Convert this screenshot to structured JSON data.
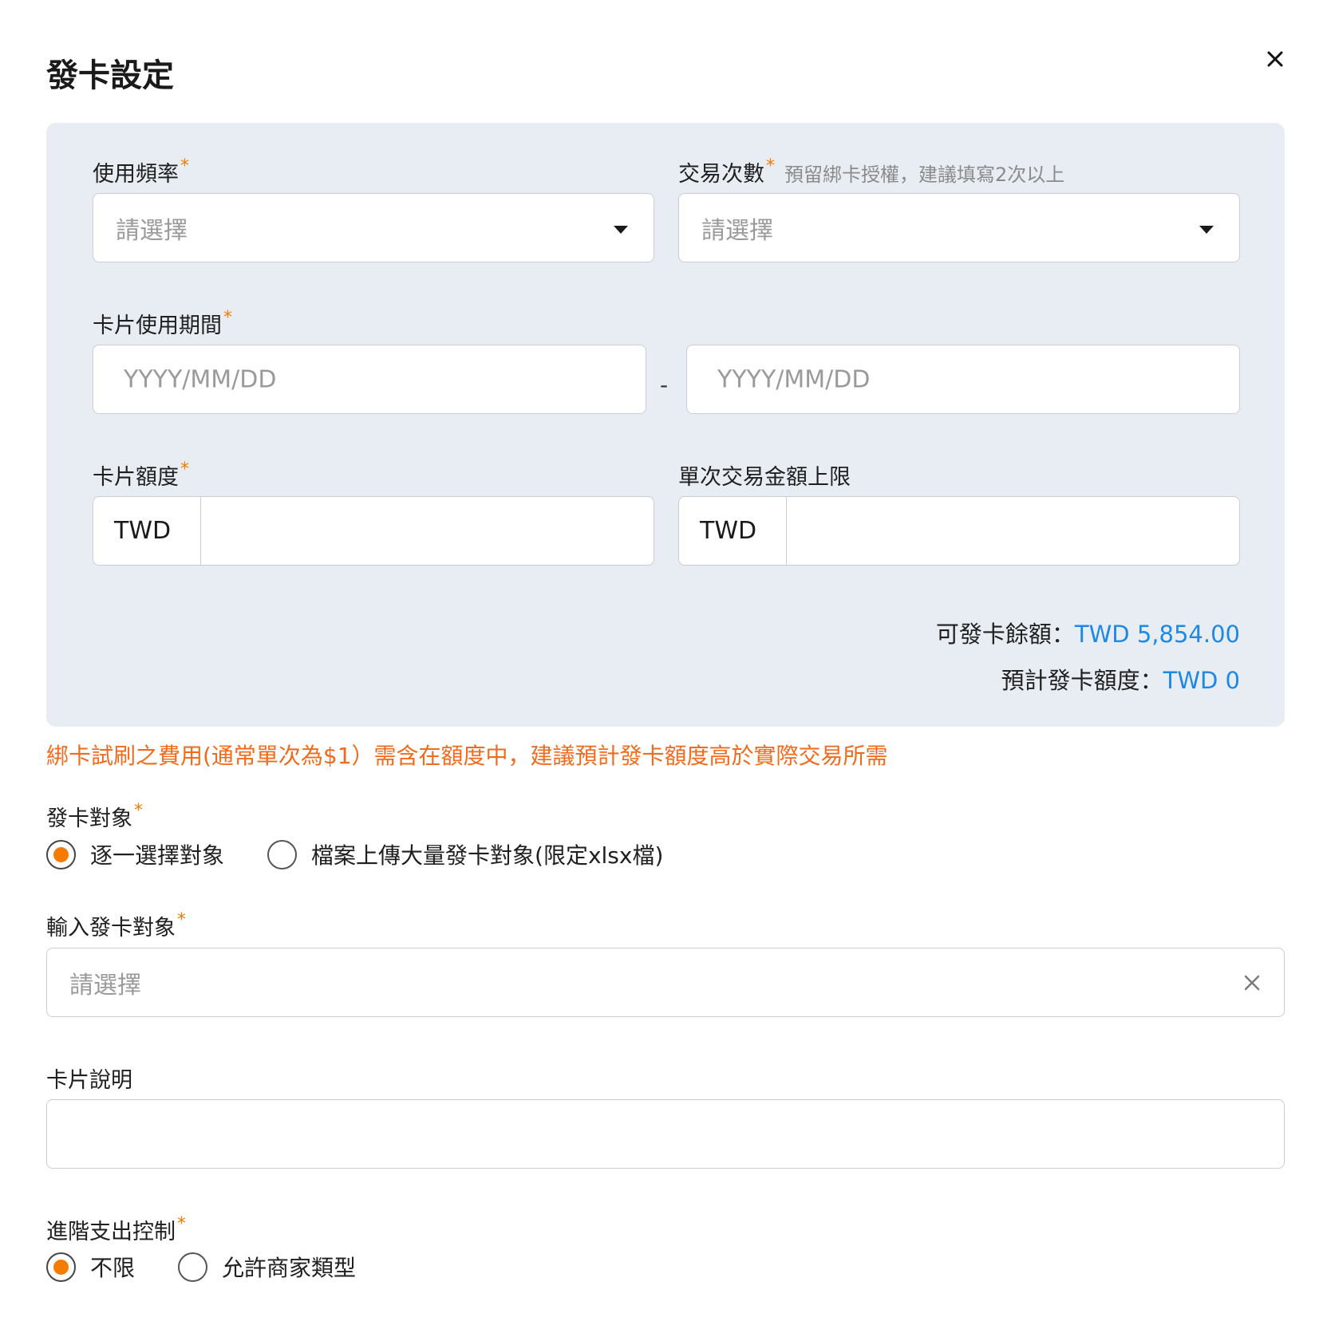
{
  "dialog": {
    "title": "發卡設定"
  },
  "usage_frequency": {
    "label": "使用頻率",
    "required": "*",
    "placeholder": "請選擇"
  },
  "transaction_count": {
    "label": "交易次數",
    "required": "*",
    "hint": "預留綁卡授權，建議填寫2次以上",
    "placeholder": "請選擇"
  },
  "card_period": {
    "label": "卡片使用期間",
    "required": "*",
    "start_placeholder": "YYYY/MM/DD",
    "separator": "-",
    "end_placeholder": "YYYY/MM/DD"
  },
  "card_limit": {
    "label": "卡片額度",
    "required": "*",
    "currency": "TWD",
    "value": ""
  },
  "single_tx_limit": {
    "label": "單次交易金額上限",
    "currency": "TWD",
    "value": ""
  },
  "summary": {
    "available_label": "可發卡餘額：",
    "available_value": "TWD 5,854.00",
    "estimated_label": "預計發卡額度：",
    "estimated_value": "TWD 0"
  },
  "warning": "綁卡試刷之費用(通常單次為$1）需含在額度中，建議預計發卡額度高於實際交易所需",
  "issue_target": {
    "label": "發卡對象",
    "required": "*",
    "options": [
      "逐一選擇對象",
      "檔案上傳大量發卡對象(限定xlsx檔)"
    ],
    "selected": 0
  },
  "target_input": {
    "label": "輸入發卡對象",
    "required": "*",
    "placeholder": "請選擇"
  },
  "card_description": {
    "label": "卡片說明",
    "value": ""
  },
  "advanced_control": {
    "label": "進階支出控制",
    "required": "*",
    "options": [
      "不限",
      "允許商家類型"
    ],
    "selected": 0
  },
  "colors": {
    "accent": "#f57c00",
    "link_blue": "#1e88e5",
    "panel_bg": "#e7edf3",
    "warning": "#f26a1b"
  },
  "icons": {
    "close": "close-icon",
    "dropdown": "caret-down-icon",
    "clear": "clear-icon"
  }
}
